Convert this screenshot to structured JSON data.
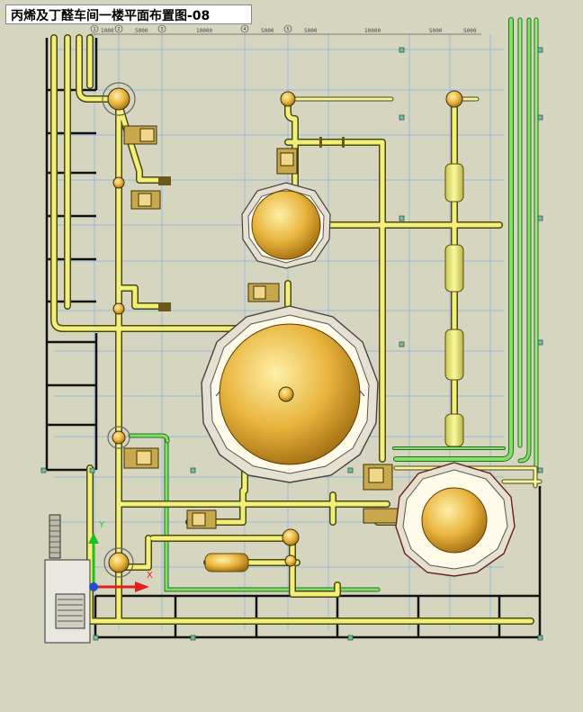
{
  "drawing": {
    "title": "丙烯及丁醛车间一楼平面布置图-08"
  },
  "ucs": {
    "x_label": "X",
    "y_label": "Y"
  },
  "dimension_text": [
    "1000",
    "5000",
    "10000",
    "5000",
    "5000",
    "10000",
    "5000",
    "5000"
  ],
  "grid_bubbles": [
    "1",
    "2",
    "3",
    "4",
    "5"
  ],
  "colors": {
    "background": "#d6d6c0",
    "pipe_yellow": "#f2f07a",
    "pipe_green": "#7fe06a",
    "vessel_gold": "#e8b43c",
    "grid_blue": "#7fb0e6",
    "axis_red": "#e02020",
    "axis_green": "#20c020"
  },
  "icons": {
    "ucs": "ucs-axis-icon"
  }
}
